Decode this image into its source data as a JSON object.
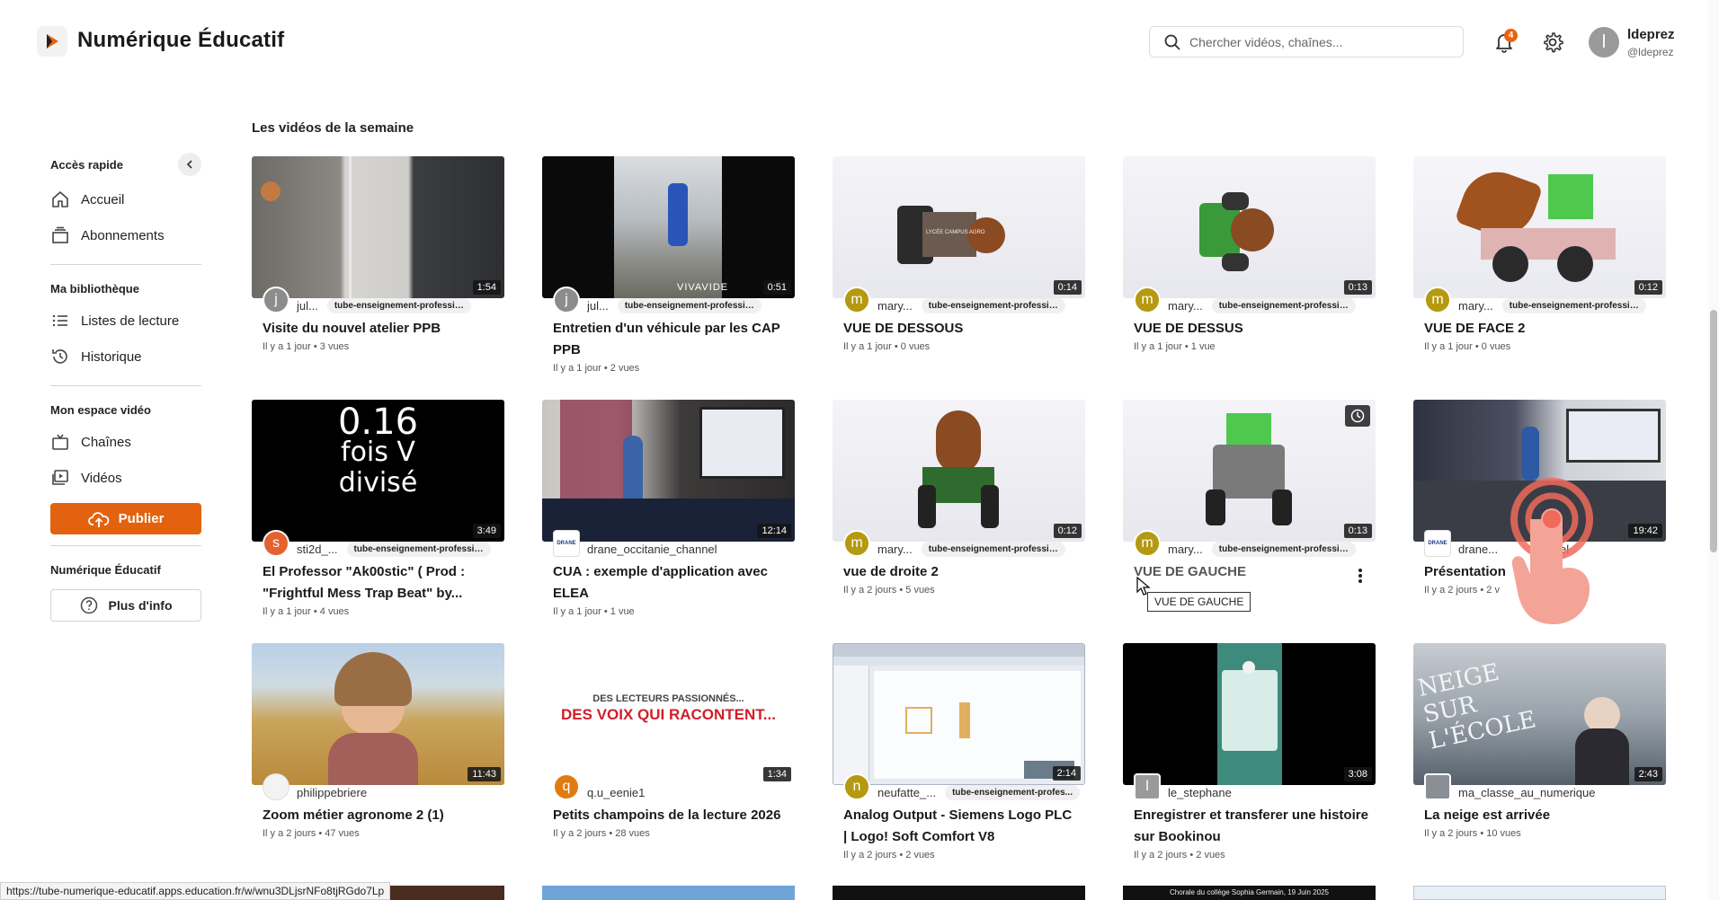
{
  "header": {
    "brand": "Numérique Éducatif",
    "search_placeholder": "Chercher vidéos, chaînes...",
    "notification_count": "4",
    "user_initial": "l",
    "user_name": "ldeprez",
    "user_handle": "@ldeprez"
  },
  "sidebar": {
    "quick_access": "Accès rapide",
    "home": "Accueil",
    "subscriptions": "Abonnements",
    "library": "Ma bibliothèque",
    "playlists": "Listes de lecture",
    "history": "Historique",
    "video_space": "Mon espace vidéo",
    "channels": "Chaînes",
    "videos": "Vidéos",
    "publish": "Publier",
    "org": "Numérique Éducatif",
    "more_info": "Plus d'info"
  },
  "main": {
    "section_title": "Les vidéos de la semaine",
    "tooltip": "VUE DE GAUCHE",
    "status_url": "https://tube-numerique-educatif.apps.education.fr/w/wnu3DLjsrNFo8tjRGdo7Lp",
    "videos": [
      {
        "title": "Visite du nouvel atelier PPB",
        "meta": "Il y a 1 jour • 3 vues",
        "duration": "1:54",
        "avatar": "j",
        "avatar_color": "#8c8c8c",
        "channel": "jul...",
        "tag": "tube-enseignement-professionnel...."
      },
      {
        "title": "Entretien d'un véhicule par les CAP PPB",
        "meta": "Il y a 1 jour • 2 vues",
        "duration": "0:51",
        "avatar": "j",
        "avatar_color": "#8c8c8c",
        "channel": "jul...",
        "tag": "tube-enseignement-professionnel...."
      },
      {
        "title": "VUE DE DESSOUS",
        "meta": "Il y a 1 jour • 0 vues",
        "duration": "0:14",
        "avatar": "m",
        "avatar_color": "#b5990f",
        "channel": "mary...",
        "tag": "tube-enseignement-profession..."
      },
      {
        "title": "VUE DE DESSUS",
        "meta": "Il y a 1 jour • 1 vue",
        "duration": "0:13",
        "avatar": "m",
        "avatar_color": "#b5990f",
        "channel": "mary...",
        "tag": "tube-enseignement-profession..."
      },
      {
        "title": "VUE DE FACE 2",
        "meta": "Il y a 1 jour • 0 vues",
        "duration": "0:12",
        "avatar": "m",
        "avatar_color": "#b5990f",
        "channel": "mary...",
        "tag": "tube-enseignement-profession..."
      },
      {
        "title": "El Professor \"Ak00stic\" ( Prod : \"Frightful Mess Trap Beat\" by...",
        "meta": "Il y a 1 jour • 4 vues",
        "duration": "3:49",
        "avatar": "s",
        "avatar_color": "#e3622f",
        "channel": "sti2d_...",
        "tag": "tube-enseignement-professio..."
      },
      {
        "title": "CUA : exemple d'application avec ELEA",
        "meta": "Il y a 1 jour • 1 vue",
        "duration": "12:14",
        "avatar": "DRANE",
        "avatar_color": "#ffffff",
        "channel": "drane_occitanie_channel",
        "tag": ""
      },
      {
        "title": "vue de droite 2",
        "meta": "Il y a 2 jours • 5 vues",
        "duration": "0:12",
        "avatar": "m",
        "avatar_color": "#b5990f",
        "channel": "mary...",
        "tag": "tube-enseignement-profession..."
      },
      {
        "title": "VUE DE GAUCHE",
        "meta": "",
        "duration": "0:13",
        "avatar": "m",
        "avatar_color": "#b5990f",
        "channel": "mary...",
        "tag": "tube-enseignement-profession..."
      },
      {
        "title": "Présentation",
        "meta": "Il y a 2 jours • 2 v",
        "duration": "19:42",
        "avatar": "DRANE",
        "avatar_color": "#ffffff",
        "channel": "drane...",
        "tag": "hannel"
      },
      {
        "title": "Zoom métier agronome 2 (1)",
        "meta": "Il y a 2 jours • 47 vues",
        "duration": "11:43",
        "avatar": "",
        "avatar_color": "#f3f3f3",
        "channel": "philippebriere",
        "tag": ""
      },
      {
        "title": "Petits champoins de la lecture 2026",
        "meta": "Il y a 2 jours • 28 vues",
        "duration": "1:34",
        "avatar": "q",
        "avatar_color": "#e07b12",
        "channel": "q.u_eenie1",
        "tag": ""
      },
      {
        "title": "Analog Output - Siemens Logo PLC | Logo! Soft Comfort V8",
        "meta": "Il y a 2 jours • 2 vues",
        "duration": "2:14",
        "avatar": "n",
        "avatar_color": "#b5990f",
        "channel": "neufatte_...",
        "tag": "tube-enseignement-profes..."
      },
      {
        "title": "Enregistrer et transferer une histoire sur Bookinou",
        "meta": "Il y a 2 jours • 2 vues",
        "duration": "3:08",
        "avatar": "l",
        "avatar_color": "#9a9a9a",
        "channel": "le_stephane",
        "tag": ""
      },
      {
        "title": "La neige est arrivée",
        "meta": "Il y a 2 jours • 10 vues",
        "duration": "2:43",
        "avatar": "",
        "avatar_color": "#8a8f96",
        "channel": "ma_classe_au_numerique",
        "tag": ""
      }
    ],
    "thumb_texts": {
      "v6_line1": "0.16",
      "v6_line2": "fois V",
      "v6_line3": "divisé",
      "v2_brand": "VIVAVIDE",
      "v12_line1": "DES LECTEURS PASSIONNÉS...",
      "v12_line2": "DES VOIX QUI RACONTENT...",
      "v15_text": "NEIGE SUR L'ÉCOLE",
      "v3_label": "LYCÉE CAMPUS AGRO",
      "next_row_caption": "Chorale du collège Sophia Germain, 19 Juin 2025"
    }
  }
}
